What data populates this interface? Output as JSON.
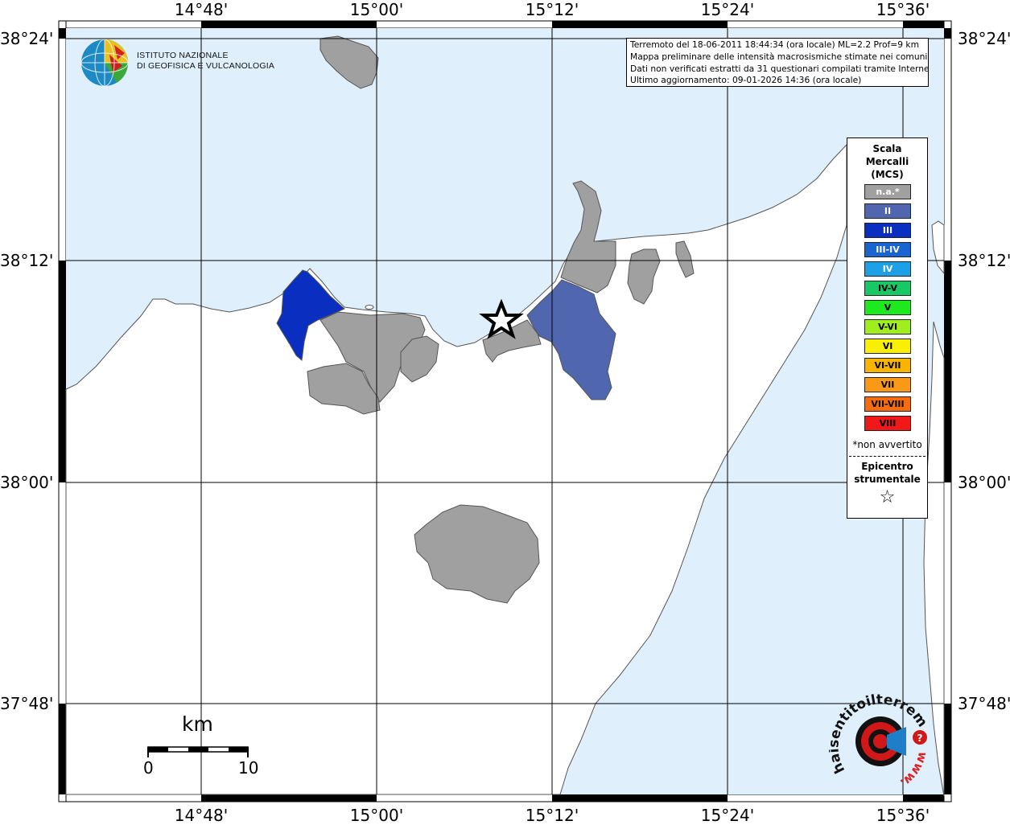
{
  "map": {
    "lon_ticks": [
      "14°48'",
      "15°00'",
      "15°12'",
      "15°24'",
      "15°36'"
    ],
    "lat_ticks": [
      "38°24'",
      "38°12'",
      "38°00'",
      "37°48'"
    ],
    "colors": {
      "sea": "#dff0fc",
      "land": "#ffffff",
      "na": "#a0a0a0",
      "II": "#5066ae",
      "III": "#0a2ec0",
      "star": "#000000"
    }
  },
  "info": {
    "line1": "Terremoto del 18-06-2011 18:44:34 (ora locale) ML=2.2 Prof=9 km",
    "line2": "Mappa preliminare delle intensità macrosismiche stimate nei comuni",
    "line3": "Dati non verificati estratti da 31 questionari compilati tramite Internet.",
    "line4": "Ultimo aggiornamento: 09-01-2026 14:36 (ora locale)"
  },
  "legend": {
    "title_line1": "Scala",
    "title_line2": "Mercalli",
    "title_line3": "(MCS)",
    "items": [
      {
        "label": "n.a.*",
        "color": "#a0a0a0",
        "text_color": "#ffffff"
      },
      {
        "label": "II",
        "color": "#5066ae",
        "text_color": "#ffffff"
      },
      {
        "label": "III",
        "color": "#0a2ec0",
        "text_color": "#ffffff"
      },
      {
        "label": "III-IV",
        "color": "#1a64d0",
        "text_color": "#ffffff"
      },
      {
        "label": "IV",
        "color": "#1ea0e6",
        "text_color": "#ffffff"
      },
      {
        "label": "IV-V",
        "color": "#18c864",
        "text_color": "#000000"
      },
      {
        "label": "V",
        "color": "#1ee81e",
        "text_color": "#000000"
      },
      {
        "label": "V-VI",
        "color": "#a0ee1e",
        "text_color": "#000000"
      },
      {
        "label": "VI",
        "color": "#f8f000",
        "text_color": "#000000"
      },
      {
        "label": "VI-VII",
        "color": "#f8b400",
        "text_color": "#000000"
      },
      {
        "label": "VII",
        "color": "#f89a18",
        "text_color": "#000000"
      },
      {
        "label": "VII-VIII",
        "color": "#f86c10",
        "text_color": "#000000"
      },
      {
        "label": "VIII",
        "color": "#f01818",
        "text_color": "#000000"
      }
    ],
    "note": "*non avvertito",
    "epicenter_line1": "Epicentro",
    "epicenter_line2": "strumentale",
    "epicenter_symbol": "☆"
  },
  "scalebar": {
    "unit": "km",
    "start": "0",
    "end": "10"
  },
  "logos": {
    "ingv_line1": "ISTITUTO NAZIONALE",
    "ingv_line2": "DI GEOFISICA E VULCANOLOGIA",
    "hsit_text": "haisentitoilterremoto.it",
    "hsit_www": "www."
  }
}
